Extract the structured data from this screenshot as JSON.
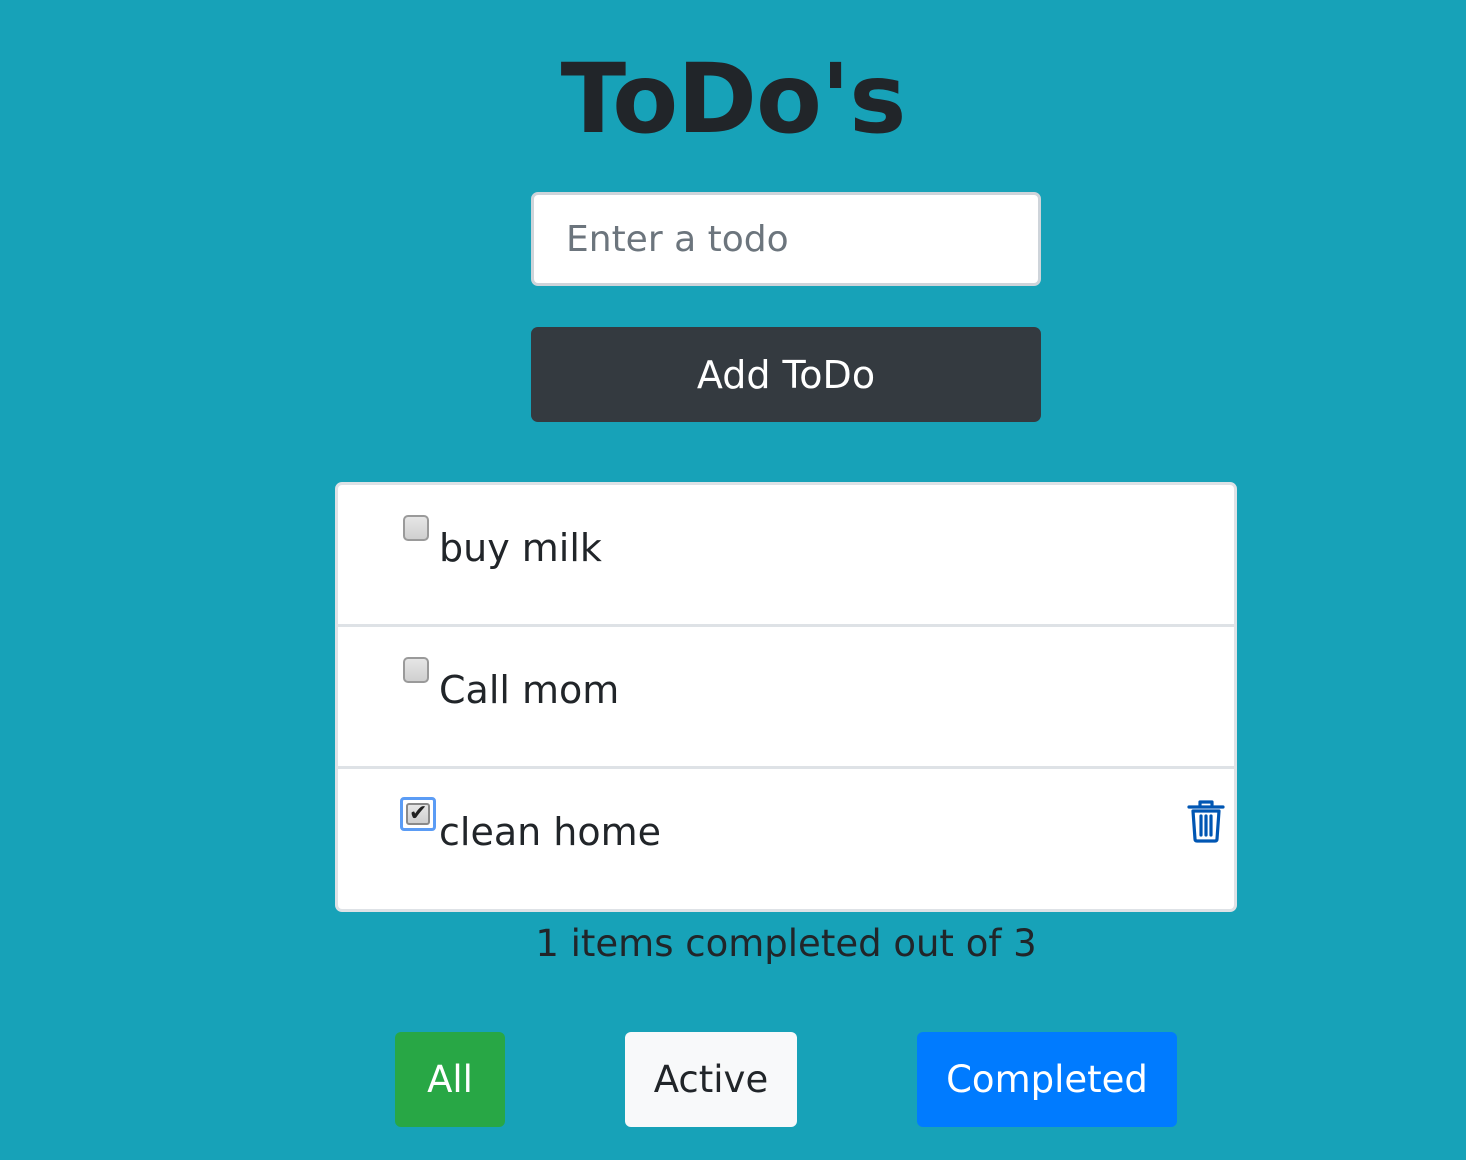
{
  "header": {
    "title": "ToDo's"
  },
  "input": {
    "placeholder": "Enter a todo",
    "value": ""
  },
  "add_button": {
    "label": "Add ToDo"
  },
  "todos": [
    {
      "text": "buy milk",
      "completed": false
    },
    {
      "text": "Call mom",
      "completed": false
    },
    {
      "text": "clean home",
      "completed": true,
      "delete_icon": "trash-icon"
    }
  ],
  "status": {
    "text": "1 items completed out of 3"
  },
  "filters": {
    "all_label": "All",
    "active_label": "Active",
    "completed_label": "Completed"
  },
  "colors": {
    "background": "#17a2b8",
    "add_button": "#343a40",
    "all_button": "#28a745",
    "active_button": "#f8f9fa",
    "completed_button": "#007bff",
    "delete_icon": "#0056b3"
  }
}
